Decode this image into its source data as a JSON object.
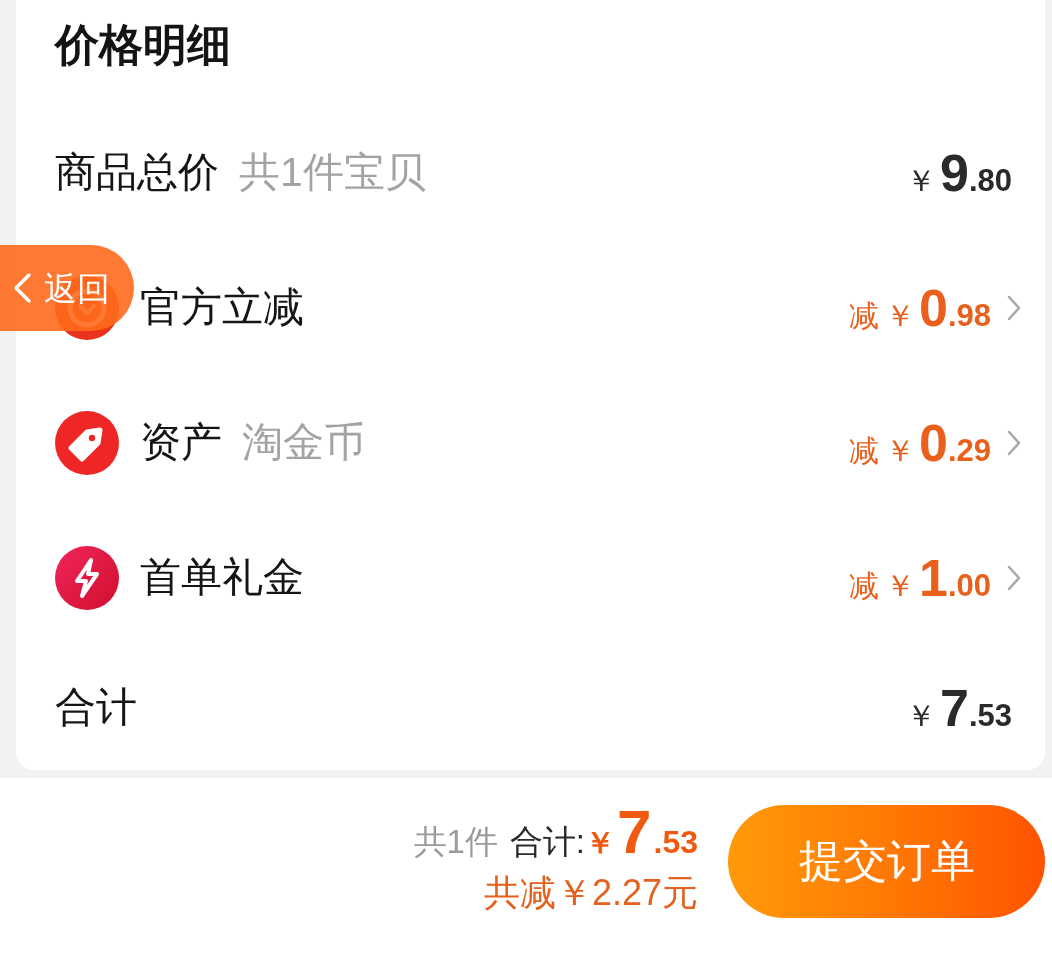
{
  "section_title": "价格明细",
  "rows": [
    {
      "kind": "subtotal",
      "label": "商品总价",
      "note": "共1件宝贝",
      "amount": {
        "currency": "￥",
        "whole": "9",
        "fraction": ".80"
      }
    },
    {
      "kind": "discount",
      "label": "官方立减",
      "amount": {
        "prefix": "减",
        "currency": "￥",
        "whole": "0",
        "fraction": ".98"
      }
    },
    {
      "kind": "discount",
      "label": "资产",
      "note": "淘金币",
      "amount": {
        "prefix": "减",
        "currency": "￥",
        "whole": "0",
        "fraction": ".29"
      }
    },
    {
      "kind": "discount",
      "label": "首单礼金",
      "amount": {
        "prefix": "减",
        "currency": "￥",
        "whole": "1",
        "fraction": ".00"
      }
    },
    {
      "kind": "total",
      "label": "合计",
      "amount": {
        "currency": "￥",
        "whole": "7",
        "fraction": ".53"
      }
    }
  ],
  "back_button": {
    "label": "返回"
  },
  "footer": {
    "item_count": "共1件",
    "total_label": "合计:",
    "total": {
      "currency": "￥",
      "whole": "7",
      "fraction": ".53"
    },
    "savings": "共减￥2.27元",
    "submit_button": "提交订单"
  }
}
